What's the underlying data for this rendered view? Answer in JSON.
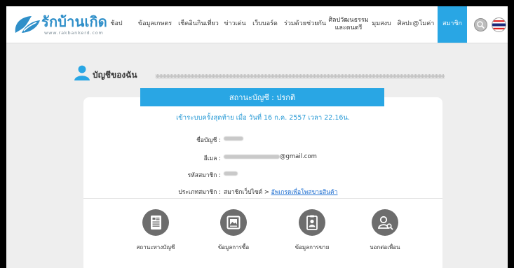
{
  "site": {
    "logo_text": "รักบ้านเกิด",
    "logo_url": "www.rakbankerd.com"
  },
  "nav": [
    {
      "id": "shop",
      "label": "ช้อป"
    },
    {
      "id": "agri",
      "label": "ข้อมูลเกษตร"
    },
    {
      "id": "travel",
      "label": "เช็คอินกินเที่ยว"
    },
    {
      "id": "news",
      "label": "ข่าวเด่น"
    },
    {
      "id": "webboard",
      "label": "เว็บบอร์ด"
    },
    {
      "id": "help",
      "label": "ร่วมด้วยช่วยกัน"
    },
    {
      "id": "culture",
      "label": "ศิลปวัฒนธรรม\nและดนตรี"
    },
    {
      "id": "corner",
      "label": "มุมสงบ"
    },
    {
      "id": "otop",
      "label": "ศิลปะ@โมค่า"
    },
    {
      "id": "member",
      "label": "สมาชิก"
    }
  ],
  "page": {
    "title": "บัญชีของฉัน",
    "status_text": "สถานะบัญชี : ปรกติ",
    "last_login": "เข้าระบบครั้งสุดท้าย เมื่อ วันที่ 16 ก.ค. 2557 เวลา 22.16น."
  },
  "account": {
    "name_label": "ชื่อบัญชี :",
    "email_label": "อีเมล :",
    "email_suffix": "@gmail.com",
    "member_id_label": "รหัสสมาชิก :",
    "member_type_label": "ประเภทสมาชิก :",
    "member_type_value": "สมาชิกเว็ปไซต์ > ",
    "upgrade_link": "อัพเกรดเพื่อโพสขายสินค้า"
  },
  "menu": [
    {
      "id": "account-status",
      "label": "สถานะทางบัญชี",
      "icon": "document-list-icon"
    },
    {
      "id": "purchase-info",
      "label": "ข้อมูลการซื้อ",
      "icon": "picture-frame-icon"
    },
    {
      "id": "sales-info",
      "label": "ข้อมูลการขาย",
      "icon": "id-badge-icon"
    },
    {
      "id": "invite-friends",
      "label": "บอกต่อเพื่อน",
      "icon": "user-search-icon"
    }
  ],
  "colors": {
    "accent": "#29a6e4",
    "link": "#1f6fd1",
    "icon_bg": "#6d6d6d"
  }
}
